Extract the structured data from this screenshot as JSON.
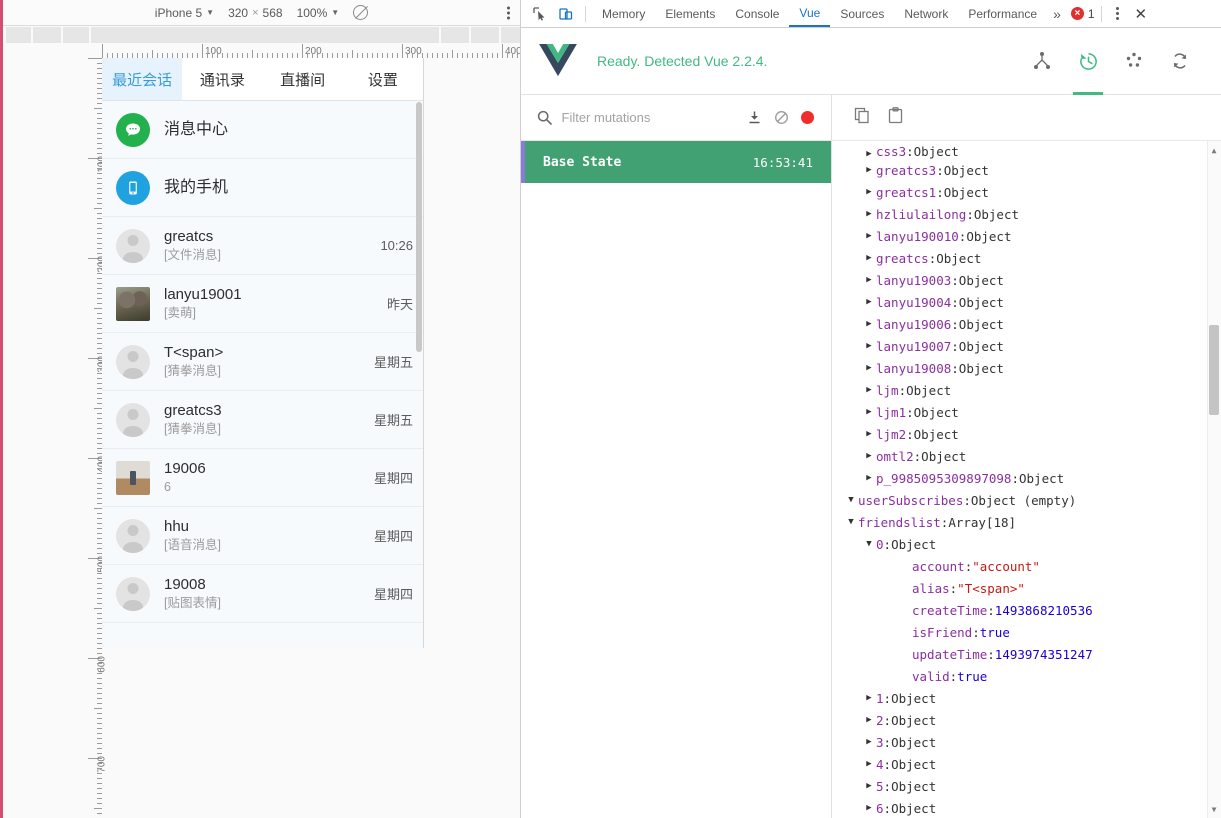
{
  "device_toolbar": {
    "device_label": "iPhone 5",
    "width": "320",
    "times": "×",
    "height": "568",
    "zoom": "100%",
    "throttle_icon": "no-throttling-icon",
    "menu_icon": "kebab-menu-icon"
  },
  "ruler": {
    "horizontal_labels": [
      "100",
      "200",
      "300",
      "400"
    ],
    "vertical_labels": [
      "100",
      "200",
      "300",
      "400",
      "500",
      "600",
      "700"
    ]
  },
  "app": {
    "tabs": [
      {
        "label": "最近会话",
        "active": true
      },
      {
        "label": "通讯录",
        "active": false
      },
      {
        "label": "直播间",
        "active": false
      },
      {
        "label": "设置",
        "active": false
      }
    ],
    "chats": [
      {
        "name": "消息中心",
        "sub": "",
        "time": "",
        "avatar": "message-center-icon",
        "avatar_kind": "green"
      },
      {
        "name": "我的手机",
        "sub": "",
        "time": "",
        "avatar": "my-phone-icon",
        "avatar_kind": "blue"
      },
      {
        "name": "greatcs",
        "sub": "[文件消息]",
        "time": "10:26",
        "avatar": "default-user-avatar",
        "avatar_kind": "gray"
      },
      {
        "name": "lanyu19001",
        "sub": "[卖萌]",
        "time": "昨天",
        "avatar": "koala-photo-avatar",
        "avatar_kind": "photo-koala"
      },
      {
        "name": "T<span>",
        "sub": "[猜拳消息]",
        "time": "星期五",
        "avatar": "default-user-avatar",
        "avatar_kind": "gray"
      },
      {
        "name": "greatcs3",
        "sub": "[猜拳消息]",
        "time": "星期五",
        "avatar": "default-user-avatar",
        "avatar_kind": "gray"
      },
      {
        "name": "19006",
        "sub": "6",
        "time": "星期四",
        "avatar": "room-photo-avatar",
        "avatar_kind": "photo-room"
      },
      {
        "name": "hhu",
        "sub": "[语音消息]",
        "time": "星期四",
        "avatar": "default-user-avatar",
        "avatar_kind": "gray"
      },
      {
        "name": "19008",
        "sub": "[贴图表情]",
        "time": "星期四",
        "avatar": "default-user-avatar",
        "avatar_kind": "gray"
      }
    ]
  },
  "devtools": {
    "inspect_icon": "inspect-element-icon",
    "device_toggle_icon": "toggle-device-toolbar-icon",
    "tabs": [
      {
        "label": "Memory",
        "active": false
      },
      {
        "label": "Elements",
        "active": false
      },
      {
        "label": "Console",
        "active": false
      },
      {
        "label": "Vue",
        "active": true
      },
      {
        "label": "Sources",
        "active": false
      },
      {
        "label": "Network",
        "active": false
      },
      {
        "label": "Performance",
        "active": false
      }
    ],
    "more_tabs_icon": "chevron-double-right-icon",
    "error_count": "1",
    "error_icon": "error-badge-icon",
    "menu_icon": "kebab-menu-icon",
    "close_icon": "close-icon"
  },
  "vue_panel": {
    "logo_icon": "vue-logo-icon",
    "status": "Ready. Detected Vue 2.2.4.",
    "tools": [
      {
        "icon": "components-tree-icon",
        "active": false
      },
      {
        "icon": "vuex-history-icon",
        "active": true
      },
      {
        "icon": "events-icon",
        "active": false
      },
      {
        "icon": "refresh-icon",
        "active": false
      }
    ],
    "filter": {
      "placeholder": "Filter mutations",
      "value": "",
      "search_icon": "search-icon",
      "export_icon": "export-icon",
      "clear_icon": "clear-disabled-icon",
      "record_icon": "record-dot-icon"
    },
    "mutations": [
      {
        "name": "Base State",
        "time": "16:53:41",
        "selected": true
      }
    ],
    "state_toolbar": {
      "copy_icon": "copy-icon",
      "paste_icon": "clipboard-icon"
    },
    "tree": [
      {
        "indent": 2,
        "arrow": "right",
        "key": "css3",
        "sep": ":",
        "value": "Object",
        "value_type": "plain",
        "clipped": true
      },
      {
        "indent": 2,
        "arrow": "right",
        "key": "greatcs3",
        "sep": ":",
        "value": "Object",
        "value_type": "plain"
      },
      {
        "indent": 2,
        "arrow": "right",
        "key": "greatcs1",
        "sep": ":",
        "value": "Object",
        "value_type": "plain"
      },
      {
        "indent": 2,
        "arrow": "right",
        "key": "hzliulailong",
        "sep": ":",
        "value": "Object",
        "value_type": "plain"
      },
      {
        "indent": 2,
        "arrow": "right",
        "key": "lanyu190010",
        "sep": ":",
        "value": "Object",
        "value_type": "plain"
      },
      {
        "indent": 2,
        "arrow": "right",
        "key": "greatcs",
        "sep": ":",
        "value": "Object",
        "value_type": "plain"
      },
      {
        "indent": 2,
        "arrow": "right",
        "key": "lanyu19003",
        "sep": ":",
        "value": "Object",
        "value_type": "plain"
      },
      {
        "indent": 2,
        "arrow": "right",
        "key": "lanyu19004",
        "sep": ":",
        "value": "Object",
        "value_type": "plain"
      },
      {
        "indent": 2,
        "arrow": "right",
        "key": "lanyu19006",
        "sep": ":",
        "value": "Object",
        "value_type": "plain"
      },
      {
        "indent": 2,
        "arrow": "right",
        "key": "lanyu19007",
        "sep": ":",
        "value": "Object",
        "value_type": "plain"
      },
      {
        "indent": 2,
        "arrow": "right",
        "key": "lanyu19008",
        "sep": ":",
        "value": "Object",
        "value_type": "plain"
      },
      {
        "indent": 2,
        "arrow": "right",
        "key": "ljm",
        "sep": ":",
        "value": "Object",
        "value_type": "plain"
      },
      {
        "indent": 2,
        "arrow": "right",
        "key": "ljm1",
        "sep": ":",
        "value": "Object",
        "value_type": "plain"
      },
      {
        "indent": 2,
        "arrow": "right",
        "key": "ljm2",
        "sep": ":",
        "value": "Object",
        "value_type": "plain"
      },
      {
        "indent": 2,
        "arrow": "right",
        "key": "omtl2",
        "sep": ":",
        "value": "Object",
        "value_type": "plain"
      },
      {
        "indent": 2,
        "arrow": "right",
        "key": "p_9985095309897098",
        "sep": ":",
        "value": "Object",
        "value_type": "plain"
      },
      {
        "indent": 1,
        "arrow": "down",
        "key": "userSubscribes",
        "sep": ":",
        "value": "Object (empty)",
        "value_type": "plain"
      },
      {
        "indent": 1,
        "arrow": "down",
        "key": "friendslist",
        "sep": ":",
        "value": "Array[18]",
        "value_type": "plain"
      },
      {
        "indent": 2,
        "arrow": "down",
        "key": "0",
        "sep": ":",
        "value": "Object",
        "value_type": "plain"
      },
      {
        "indent": 4,
        "arrow": "none",
        "key": "account",
        "sep": ":",
        "value": "\"account\"",
        "value_type": "str"
      },
      {
        "indent": 4,
        "arrow": "none",
        "key": "alias",
        "sep": ":",
        "value": "\"T<span>\"",
        "value_type": "str"
      },
      {
        "indent": 4,
        "arrow": "none",
        "key": "createTime",
        "sep": ":",
        "value": "1493868210536",
        "value_type": "num"
      },
      {
        "indent": 4,
        "arrow": "none",
        "key": "isFriend",
        "sep": ":",
        "value": "true",
        "value_type": "bool"
      },
      {
        "indent": 4,
        "arrow": "none",
        "key": "updateTime",
        "sep": ":",
        "value": "1493974351247",
        "value_type": "num"
      },
      {
        "indent": 4,
        "arrow": "none",
        "key": "valid",
        "sep": ":",
        "value": "true",
        "value_type": "bool"
      },
      {
        "indent": 2,
        "arrow": "right",
        "key": "1",
        "sep": ":",
        "value": "Object",
        "value_type": "plain"
      },
      {
        "indent": 2,
        "arrow": "right",
        "key": "2",
        "sep": ":",
        "value": "Object",
        "value_type": "plain"
      },
      {
        "indent": 2,
        "arrow": "right",
        "key": "3",
        "sep": ":",
        "value": "Object",
        "value_type": "plain"
      },
      {
        "indent": 2,
        "arrow": "right",
        "key": "4",
        "sep": ":",
        "value": "Object",
        "value_type": "plain"
      },
      {
        "indent": 2,
        "arrow": "right",
        "key": "5",
        "sep": ":",
        "value": "Object",
        "value_type": "plain"
      },
      {
        "indent": 2,
        "arrow": "right",
        "key": "6",
        "sep": ":",
        "value": "Object",
        "value_type": "plain"
      }
    ]
  },
  "colors": {
    "vue_green": "#42b983",
    "mutation_green": "#42a173",
    "devtools_blue": "#1a73c7",
    "error_red": "#df2f2f",
    "device_border": "#d44f6e"
  }
}
